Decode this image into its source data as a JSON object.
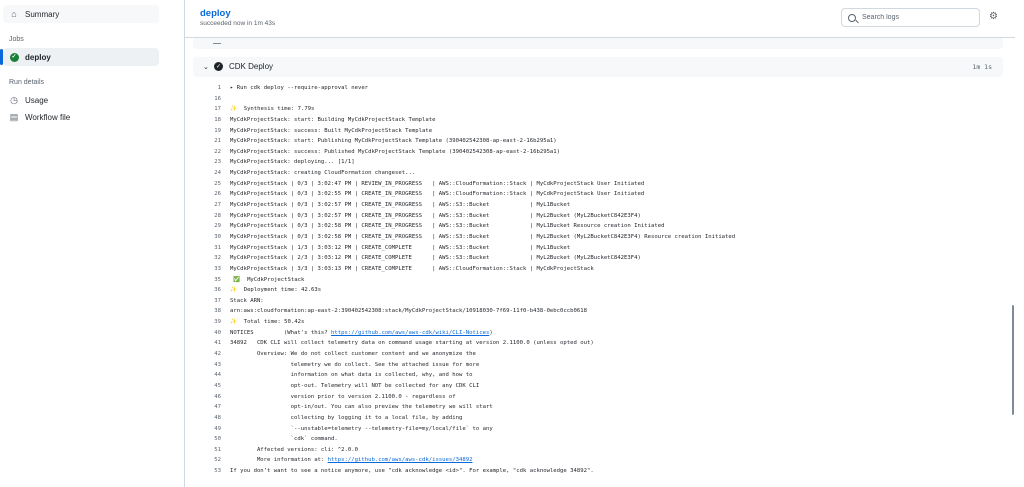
{
  "sidebar": {
    "summary": "Summary",
    "jobs_heading": "Jobs",
    "job_deploy": "deploy",
    "run_details_heading": "Run details",
    "usage": "Usage",
    "workflow_file": "Workflow file"
  },
  "header": {
    "title": "deploy",
    "subtitle": "succeeded now in 1m 43s",
    "search_placeholder": "Search logs"
  },
  "step": {
    "name": "CDK Deploy",
    "duration": "1m 1s"
  },
  "log": [
    {
      "n": "1",
      "t": "Run cdk deploy --require-approval never"
    },
    {
      "n": "16",
      "t": ""
    },
    {
      "n": "17",
      "t": "✨  Synthesis time: 7.79s"
    },
    {
      "n": "18",
      "t": "MyCdkProjectStack: start: Building MyCdkProjectStack Template"
    },
    {
      "n": "19",
      "t": "MyCdkProjectStack: success: Built MyCdkProjectStack Template"
    },
    {
      "n": "21",
      "t": "MyCdkProjectStack: start: Publishing MyCdkProjectStack Template (390402542308-ap-east-2-16b295a1)"
    },
    {
      "n": "22",
      "t": "MyCdkProjectStack: success: Published MyCdkProjectStack Template (390402542308-ap-east-2-16b295a1)"
    },
    {
      "n": "23",
      "t": "MyCdkProjectStack: deploying... [1/1]"
    },
    {
      "n": "24",
      "t": "MyCdkProjectStack: creating CloudFormation changeset..."
    },
    {
      "n": "25",
      "t": "MyCdkProjectStack | 0/3 | 3:02:47 PM | REVIEW_IN_PROGRESS   | AWS::CloudFormation::Stack | MyCdkProjectStack User Initiated"
    },
    {
      "n": "26",
      "t": "MyCdkProjectStack | 0/3 | 3:02:55 PM | CREATE_IN_PROGRESS   | AWS::CloudFormation::Stack | MyCdkProjectStack User Initiated"
    },
    {
      "n": "27",
      "t": "MyCdkProjectStack | 0/3 | 3:02:57 PM | CREATE_IN_PROGRESS   | AWS::S3::Bucket            | MyL1Bucket"
    },
    {
      "n": "28",
      "t": "MyCdkProjectStack | 0/3 | 3:02:57 PM | CREATE_IN_PROGRESS   | AWS::S3::Bucket            | MyL2Bucket (MyL2BucketC842E3F4)"
    },
    {
      "n": "29",
      "t": "MyCdkProjectStack | 0/3 | 3:02:58 PM | CREATE_IN_PROGRESS   | AWS::S3::Bucket            | MyL1Bucket Resource creation Initiated"
    },
    {
      "n": "30",
      "t": "MyCdkProjectStack | 0/3 | 3:02:58 PM | CREATE_IN_PROGRESS   | AWS::S3::Bucket            | MyL2Bucket (MyL2BucketC842E3F4) Resource creation Initiated"
    },
    {
      "n": "31",
      "t": "MyCdkProjectStack | 1/3 | 3:03:12 PM | CREATE_COMPLETE      | AWS::S3::Bucket            | MyL1Bucket"
    },
    {
      "n": "32",
      "t": "MyCdkProjectStack | 2/3 | 3:03:12 PM | CREATE_COMPLETE      | AWS::S3::Bucket            | MyL2Bucket (MyL2BucketC842E3F4)"
    },
    {
      "n": "33",
      "t": "MyCdkProjectStack | 3/3 | 3:03:13 PM | CREATE_COMPLETE      | AWS::CloudFormation::Stack | MyCdkProjectStack"
    },
    {
      "n": "35",
      "t": " ✅  MyCdkProjectStack"
    },
    {
      "n": "36",
      "t": "✨  Deployment time: 42.63s"
    },
    {
      "n": "37",
      "t": "Stack ARN:"
    },
    {
      "n": "38",
      "t": "arn:aws:cloudformation:ap-east-2:390402542308:stack/MyCdkProjectStack/10918030-7f69-11f0-b438-0ebc0ccb0618"
    },
    {
      "n": "39",
      "t": "✨  Total time: 50.42s"
    },
    {
      "n": "40",
      "t": "NOTICES         (What's this? ",
      "link": "https://github.com/aws/aws-cdk/wiki/CLI-Notices",
      "after": ")"
    },
    {
      "n": "41",
      "t": "34892   CDK CLI will collect telemetry data on command usage starting at version 2.1100.0 (unless opted out)"
    },
    {
      "n": "42",
      "t": "        Overview: We do not collect customer content and we anonymize the"
    },
    {
      "n": "43",
      "t": "                  telemetry we do collect. See the attached issue for more"
    },
    {
      "n": "44",
      "t": "                  information on what data is collected, why, and how to"
    },
    {
      "n": "45",
      "t": "                  opt-out. Telemetry will NOT be collected for any CDK CLI"
    },
    {
      "n": "46",
      "t": "                  version prior to version 2.1100.0 - regardless of"
    },
    {
      "n": "47",
      "t": "                  opt-in/out. You can also preview the telemetry we will start"
    },
    {
      "n": "48",
      "t": "                  collecting by logging it to a local file, by adding"
    },
    {
      "n": "49",
      "t": "                  `--unstable=telemetry --telemetry-file=my/local/file` to any"
    },
    {
      "n": "50",
      "t": "                  `cdk` command."
    },
    {
      "n": "51",
      "t": "        Affected versions: cli: ^2.0.0"
    },
    {
      "n": "52",
      "t": "        More information at: ",
      "link": "https://github.com/aws/aws-cdk/issues/34892",
      "after": ""
    },
    {
      "n": "53",
      "t": "If you don’t want to see a notice anymore, use \"cdk acknowledge <id>\". For example, \"cdk acknowledge 34892\"."
    }
  ],
  "colors": {
    "accent": "#0969da",
    "success": "#1a7f37"
  }
}
